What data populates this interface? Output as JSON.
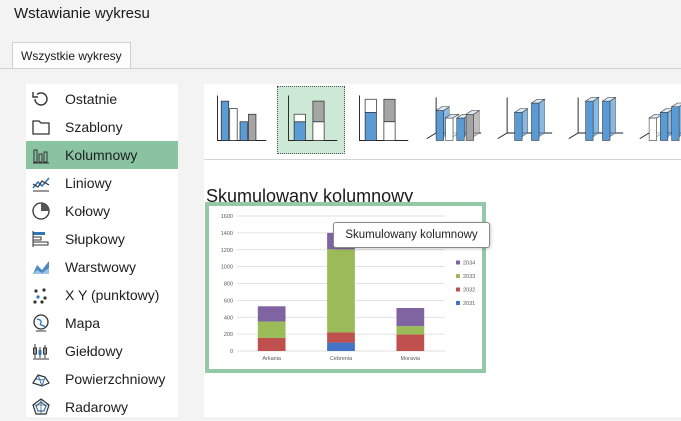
{
  "window": {
    "title": "Wstawianie wykresu"
  },
  "tabs": [
    {
      "label": "Wszystkie wykresy"
    }
  ],
  "chart_types": [
    {
      "label": "Ostatnie",
      "icon": "recent-icon"
    },
    {
      "label": "Szablony",
      "icon": "folder-icon"
    },
    {
      "label": "Kolumnowy",
      "icon": "column-chart-icon",
      "selected": true
    },
    {
      "label": "Liniowy",
      "icon": "line-chart-icon"
    },
    {
      "label": "Kołowy",
      "icon": "pie-chart-icon"
    },
    {
      "label": "Słupkowy",
      "icon": "bar-chart-icon"
    },
    {
      "label": "Warstwowy",
      "icon": "area-chart-icon"
    },
    {
      "label": "X Y (punktowy)",
      "icon": "scatter-chart-icon"
    },
    {
      "label": "Mapa",
      "icon": "map-chart-icon"
    },
    {
      "label": "Giełdowy",
      "icon": "stock-chart-icon"
    },
    {
      "label": "Powierzchniowy",
      "icon": "surface-chart-icon"
    },
    {
      "label": "Radarowy",
      "icon": "radar-chart-icon"
    }
  ],
  "subtypes": [
    {
      "icon": "clustered-column-icon"
    },
    {
      "icon": "stacked-column-icon",
      "selected": true
    },
    {
      "icon": "percent-stacked-column-icon"
    },
    {
      "icon": "3d-clustered-column-icon"
    },
    {
      "icon": "3d-stacked-column-icon"
    },
    {
      "icon": "3d-percent-stacked-column-icon"
    },
    {
      "icon": "3d-column-icon"
    }
  ],
  "tooltip": "Skumulowany kolumnowy",
  "preview_title": "Skumulowany kolumnowy",
  "colors": {
    "accent": "#89c3a1",
    "selected_subtype": "#cde8d5",
    "icon_blue": "#2e75b6"
  },
  "chart_data": {
    "type": "bar",
    "stacked": true,
    "categories": [
      "Arkania",
      "Cebrenia",
      "Moravia"
    ],
    "series": [
      {
        "name": "2031",
        "color": "#4472c4",
        "values": [
          0,
          100,
          0
        ]
      },
      {
        "name": "2032",
        "color": "#c0504d",
        "values": [
          155,
          120,
          195
        ]
      },
      {
        "name": "2033",
        "color": "#9bbb59",
        "values": [
          195,
          985,
          100
        ]
      },
      {
        "name": "2034",
        "color": "#8064a2",
        "values": [
          180,
          195,
          215
        ]
      }
    ],
    "ylim": [
      0,
      1600
    ],
    "yticks": [
      "0",
      "200",
      "400",
      "600",
      "800",
      "1000",
      "1200",
      "1400",
      "1600"
    ],
    "grid": true,
    "legend_position": "right"
  }
}
